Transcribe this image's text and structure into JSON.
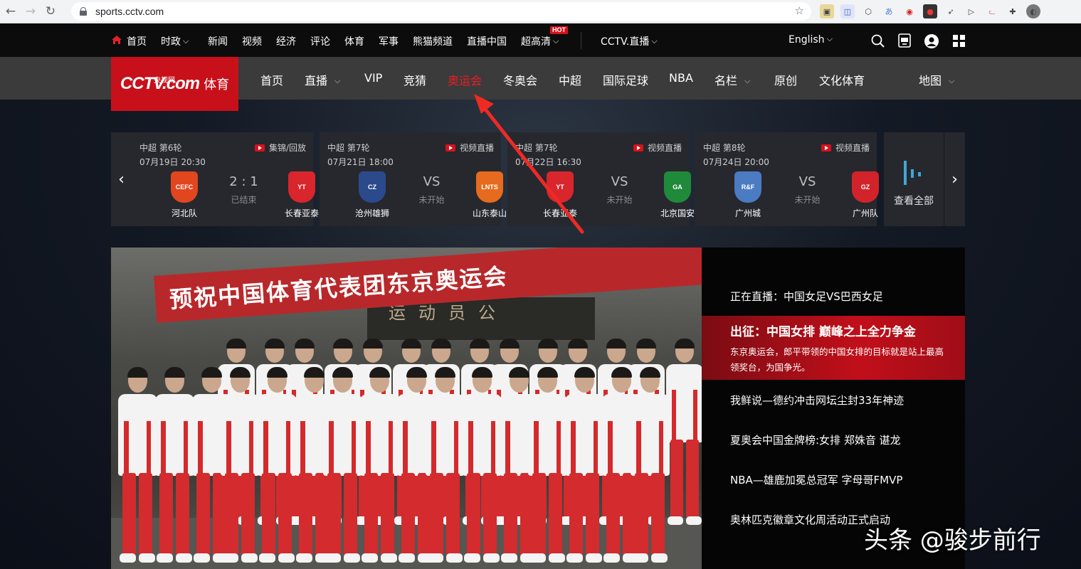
{
  "browser": {
    "url": "sports.cctv.com"
  },
  "topnav": {
    "home": "首页",
    "politics": "时政",
    "news": "新闻",
    "video": "视频",
    "economy": "经济",
    "comment": "评论",
    "sports": "体育",
    "military": "军事",
    "panda": "熊猫频道",
    "live_china": "直播中国",
    "uhd": "超高清",
    "hot": "HOT",
    "cctv_live": "CCTV.直播",
    "english": "English"
  },
  "logo": {
    "main": "CCTV.com",
    "small": "央视网",
    "sub": "体育"
  },
  "channels": [
    {
      "label": "首页"
    },
    {
      "label": "直播",
      "dropdown": true
    },
    {
      "label": "VIP"
    },
    {
      "label": "竞猜"
    },
    {
      "label": "奥运会",
      "active": true
    },
    {
      "label": "冬奥会"
    },
    {
      "label": "中超"
    },
    {
      "label": "国际足球"
    },
    {
      "label": "NBA"
    },
    {
      "label": "名栏",
      "dropdown": true
    },
    {
      "label": "原创"
    },
    {
      "label": "文化体育"
    },
    {
      "label": "地图",
      "dropdown": true
    }
  ],
  "matches": [
    {
      "league": "中超 第6轮",
      "time": "07月19日 20:30",
      "video": "集锦/回放",
      "score": "2 : 1",
      "status": "已结束",
      "home": "河北队",
      "away": "长春亚泰",
      "home_color": "#e2461f",
      "away_color": "#d8262c"
    },
    {
      "league": "中超 第7轮",
      "time": "07月21日 18:00",
      "video": "视频直播",
      "score": "VS",
      "status": "未开始",
      "home": "沧州雄狮",
      "away": "山东泰山",
      "home_color": "#2b4a8c",
      "away_color": "#e66b1e"
    },
    {
      "league": "中超 第7轮",
      "time": "07月22日 16:30",
      "video": "视频直播",
      "score": "VS",
      "status": "未开始",
      "home": "长春亚泰",
      "away": "北京国安",
      "home_color": "#d8262c",
      "away_color": "#1f8a3a"
    },
    {
      "league": "中超 第8轮",
      "time": "07月24日 20:00",
      "video": "视频直播",
      "score": "VS",
      "status": "未开始",
      "home": "广州城",
      "away": "广州队",
      "home_color": "#4b7bc2",
      "away_color": "#d3232a"
    }
  ],
  "view_all": "查看全部",
  "hero": {
    "banner_text": "预祝中国体育代表团东京奥运会",
    "wall_text": "运动员公"
  },
  "news": {
    "live": "正在直播：中国女足VS巴西女足",
    "active_title": "出征：中国女排 巅峰之上全力争金",
    "active_desc": "东京奥运会，郎平带领的中国女排的目标就是站上最高领奖台，为国争光。",
    "items": [
      "我鲜说—德约冲击网坛尘封33年神迹",
      "夏奥会中国金牌榜:女排 郑姝音 谌龙",
      "NBA—雄鹿加冕总冠军 字母哥FMVP",
      "奥林匹克徽章文化周活动正式启动"
    ]
  },
  "watermark": "头条 @骏步前行",
  "colors": {
    "brand_red": "#c8101a",
    "active_red": "#ee1c25"
  }
}
